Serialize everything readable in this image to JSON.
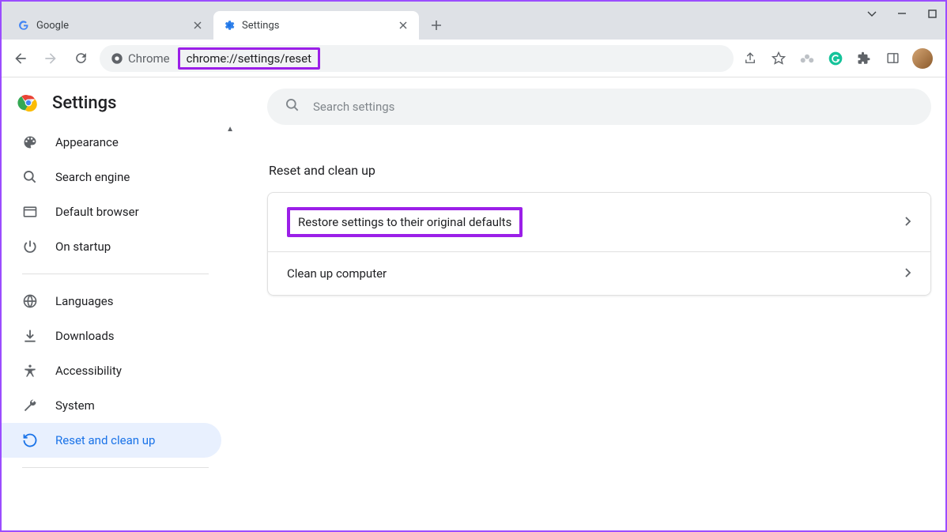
{
  "window": {
    "tabs": [
      {
        "title": "Google",
        "active": false
      },
      {
        "title": "Settings",
        "active": true
      }
    ]
  },
  "toolbar": {
    "scheme_label": "Chrome",
    "url": "chrome://settings/reset"
  },
  "page": {
    "title": "Settings",
    "search_placeholder": "Search settings"
  },
  "sidebar": {
    "items": [
      {
        "icon": "palette",
        "label": "Appearance"
      },
      {
        "icon": "search",
        "label": "Search engine"
      },
      {
        "icon": "window",
        "label": "Default browser"
      },
      {
        "icon": "power",
        "label": "On startup"
      },
      {
        "divider": true
      },
      {
        "icon": "globe",
        "label": "Languages"
      },
      {
        "icon": "download",
        "label": "Downloads"
      },
      {
        "icon": "accessibility",
        "label": "Accessibility"
      },
      {
        "icon": "wrench",
        "label": "System"
      },
      {
        "icon": "restore",
        "label": "Reset and clean up",
        "selected": true
      }
    ]
  },
  "main": {
    "section_title": "Reset and clean up",
    "rows": [
      {
        "label": "Restore settings to their original defaults",
        "highlighted": true
      },
      {
        "label": "Clean up computer",
        "highlighted": false
      }
    ]
  }
}
